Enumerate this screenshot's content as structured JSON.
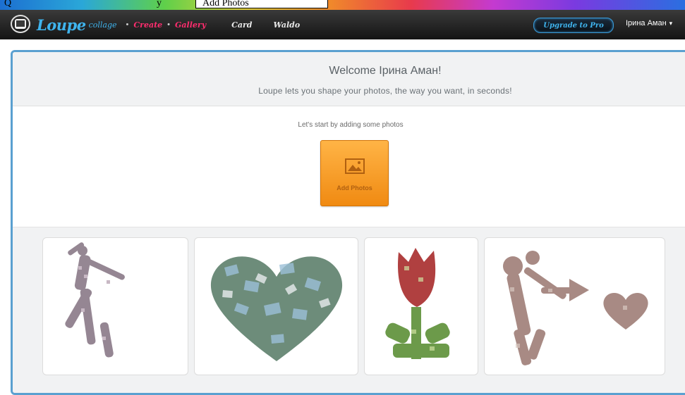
{
  "page_caption": {
    "before": "Q",
    "middle": "y",
    "boxed": "Add Photos"
  },
  "navbar": {
    "logo_word": "Loupe",
    "logo_sub": "collage",
    "links": [
      {
        "label": "Create",
        "active": true
      },
      {
        "label": "Gallery",
        "active": true
      },
      {
        "label": "Card",
        "active": false
      },
      {
        "label": "Waldo",
        "active": false
      }
    ],
    "upgrade_label": "Upgrade to Pro",
    "user_name": "Ірина Аман"
  },
  "welcome": {
    "title": "Welcome Ірина Аман!",
    "subtitle": "Loupe lets you shape your photos, the way you want, in seconds!"
  },
  "start_prompt": "Let's start by adding some photos",
  "add_photos": {
    "label": "Add Photos",
    "icon": "photo-icon"
  },
  "gallery": {
    "tiles": [
      {
        "shape": "dancing-person"
      },
      {
        "shape": "heart"
      },
      {
        "shape": "tulip"
      },
      {
        "shape": "cupid-with-heart"
      }
    ]
  },
  "colors": {
    "brand_blue": "#3fb4ee",
    "nav_pink": "#ff2d6e",
    "orange_button": "#f39a1e",
    "panel_border": "#5aa0d0"
  }
}
